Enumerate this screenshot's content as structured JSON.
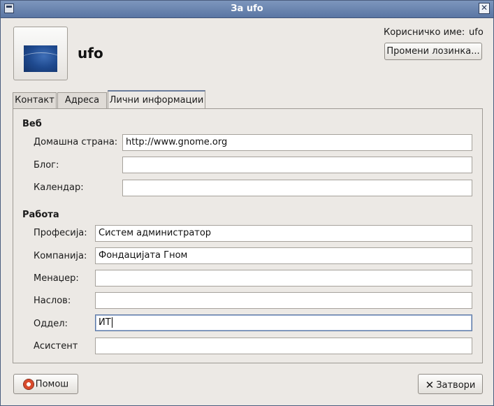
{
  "window": {
    "title": "За ufo"
  },
  "header": {
    "username_display": "ufo",
    "login_label": "Корисничко име:",
    "login_value": "ufo",
    "change_password_label": "Промени лозинка..."
  },
  "tabs": [
    {
      "label": "Контакт",
      "active": false
    },
    {
      "label": "Адреса",
      "active": false
    },
    {
      "label": "Лични информации",
      "active": true
    }
  ],
  "web": {
    "section_title": "Веб",
    "homepage": {
      "label": "Домашна страна:",
      "value": "http://www.gnome.org"
    },
    "blog": {
      "label": "Блог:",
      "value": ""
    },
    "calendar": {
      "label": "Календар:",
      "value": ""
    }
  },
  "work": {
    "section_title": "Работа",
    "profession": {
      "label": "Професија:",
      "value": "Систем администратор"
    },
    "company": {
      "label": "Компанија:",
      "value": "Фондацијата Гном"
    },
    "manager": {
      "label": "Менаџер:",
      "value": ""
    },
    "title": {
      "label": "Наслов:",
      "value": ""
    },
    "department": {
      "label": "Оддел:",
      "value": "ИТ"
    },
    "assistant": {
      "label": "Асистент",
      "value": ""
    }
  },
  "buttons": {
    "help": "Помош",
    "close": "Затвори"
  },
  "colors": {
    "titlebar": "#6a84ae",
    "window_bg": "#ece9e5",
    "focus_border": "#5a76a3"
  }
}
